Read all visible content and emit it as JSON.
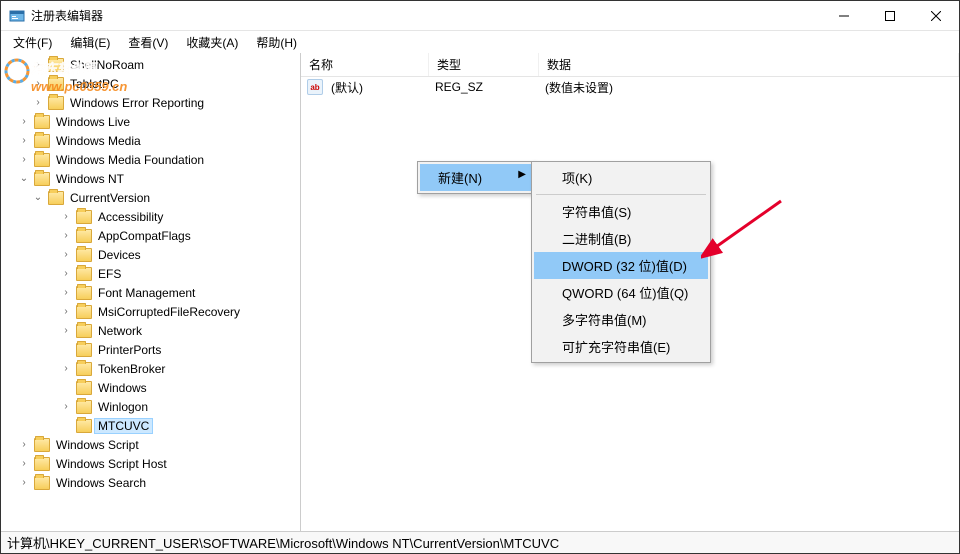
{
  "window": {
    "title": "注册表编辑器"
  },
  "watermark": {
    "line1": "河东软件园",
    "line2": "www.pc0359.cn"
  },
  "menu": {
    "file": "文件(F)",
    "edit": "编辑(E)",
    "view": "查看(V)",
    "fav": "收藏夹(A)",
    "help": "帮助(H)"
  },
  "columns": {
    "name": "名称",
    "type": "类型",
    "data": "数据"
  },
  "row": {
    "name": "(默认)",
    "type": "REG_SZ",
    "data": "(数值未设置)"
  },
  "tree": {
    "shellNoRoam": "ShellNoRoam",
    "tabletPC": "TabletPC",
    "wer": "Windows Error Reporting",
    "wlive": "Windows Live",
    "wmedia": "Windows Media",
    "wmf": "Windows Media Foundation",
    "wnt": "Windows NT",
    "cv": "CurrentVersion",
    "acc": "Accessibility",
    "acf": "AppCompatFlags",
    "dev": "Devices",
    "efs": "EFS",
    "fm": "Font Management",
    "mcfr": "MsiCorruptedFileRecovery",
    "net": "Network",
    "pp": "PrinterPorts",
    "tb": "TokenBroker",
    "win": "Windows",
    "wl": "Winlogon",
    "mtcuvc": "MTCUVC",
    "wscript": "Windows Script",
    "wsh": "Windows Script Host",
    "wsearch": "Windows Search"
  },
  "ctx": {
    "new": "新建(N)",
    "key": "项(K)",
    "string": "字符串值(S)",
    "binary": "二进制值(B)",
    "dword": "DWORD (32 位)值(D)",
    "qword": "QWORD (64 位)值(Q)",
    "multi": "多字符串值(M)",
    "expand": "可扩充字符串值(E)"
  },
  "status": {
    "path": "计算机\\HKEY_CURRENT_USER\\SOFTWARE\\Microsoft\\Windows NT\\CurrentVersion\\MTCUVC"
  }
}
